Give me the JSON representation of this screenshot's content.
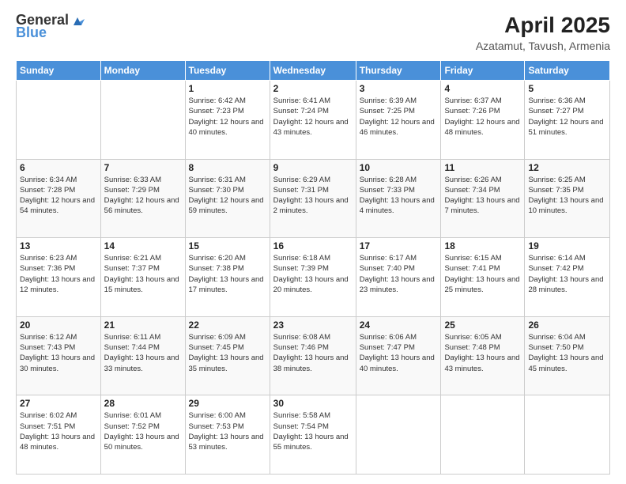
{
  "header": {
    "logo": {
      "text_general": "General",
      "text_blue": "Blue"
    },
    "title": "April 2025",
    "location": "Azatamut, Tavush, Armenia"
  },
  "calendar": {
    "days_of_week": [
      "Sunday",
      "Monday",
      "Tuesday",
      "Wednesday",
      "Thursday",
      "Friday",
      "Saturday"
    ],
    "weeks": [
      [
        {
          "day": "",
          "info": ""
        },
        {
          "day": "",
          "info": ""
        },
        {
          "day": "1",
          "info": "Sunrise: 6:42 AM\nSunset: 7:23 PM\nDaylight: 12 hours and 40 minutes."
        },
        {
          "day": "2",
          "info": "Sunrise: 6:41 AM\nSunset: 7:24 PM\nDaylight: 12 hours and 43 minutes."
        },
        {
          "day": "3",
          "info": "Sunrise: 6:39 AM\nSunset: 7:25 PM\nDaylight: 12 hours and 46 minutes."
        },
        {
          "day": "4",
          "info": "Sunrise: 6:37 AM\nSunset: 7:26 PM\nDaylight: 12 hours and 48 minutes."
        },
        {
          "day": "5",
          "info": "Sunrise: 6:36 AM\nSunset: 7:27 PM\nDaylight: 12 hours and 51 minutes."
        }
      ],
      [
        {
          "day": "6",
          "info": "Sunrise: 6:34 AM\nSunset: 7:28 PM\nDaylight: 12 hours and 54 minutes."
        },
        {
          "day": "7",
          "info": "Sunrise: 6:33 AM\nSunset: 7:29 PM\nDaylight: 12 hours and 56 minutes."
        },
        {
          "day": "8",
          "info": "Sunrise: 6:31 AM\nSunset: 7:30 PM\nDaylight: 12 hours and 59 minutes."
        },
        {
          "day": "9",
          "info": "Sunrise: 6:29 AM\nSunset: 7:31 PM\nDaylight: 13 hours and 2 minutes."
        },
        {
          "day": "10",
          "info": "Sunrise: 6:28 AM\nSunset: 7:33 PM\nDaylight: 13 hours and 4 minutes."
        },
        {
          "day": "11",
          "info": "Sunrise: 6:26 AM\nSunset: 7:34 PM\nDaylight: 13 hours and 7 minutes."
        },
        {
          "day": "12",
          "info": "Sunrise: 6:25 AM\nSunset: 7:35 PM\nDaylight: 13 hours and 10 minutes."
        }
      ],
      [
        {
          "day": "13",
          "info": "Sunrise: 6:23 AM\nSunset: 7:36 PM\nDaylight: 13 hours and 12 minutes."
        },
        {
          "day": "14",
          "info": "Sunrise: 6:21 AM\nSunset: 7:37 PM\nDaylight: 13 hours and 15 minutes."
        },
        {
          "day": "15",
          "info": "Sunrise: 6:20 AM\nSunset: 7:38 PM\nDaylight: 13 hours and 17 minutes."
        },
        {
          "day": "16",
          "info": "Sunrise: 6:18 AM\nSunset: 7:39 PM\nDaylight: 13 hours and 20 minutes."
        },
        {
          "day": "17",
          "info": "Sunrise: 6:17 AM\nSunset: 7:40 PM\nDaylight: 13 hours and 23 minutes."
        },
        {
          "day": "18",
          "info": "Sunrise: 6:15 AM\nSunset: 7:41 PM\nDaylight: 13 hours and 25 minutes."
        },
        {
          "day": "19",
          "info": "Sunrise: 6:14 AM\nSunset: 7:42 PM\nDaylight: 13 hours and 28 minutes."
        }
      ],
      [
        {
          "day": "20",
          "info": "Sunrise: 6:12 AM\nSunset: 7:43 PM\nDaylight: 13 hours and 30 minutes."
        },
        {
          "day": "21",
          "info": "Sunrise: 6:11 AM\nSunset: 7:44 PM\nDaylight: 13 hours and 33 minutes."
        },
        {
          "day": "22",
          "info": "Sunrise: 6:09 AM\nSunset: 7:45 PM\nDaylight: 13 hours and 35 minutes."
        },
        {
          "day": "23",
          "info": "Sunrise: 6:08 AM\nSunset: 7:46 PM\nDaylight: 13 hours and 38 minutes."
        },
        {
          "day": "24",
          "info": "Sunrise: 6:06 AM\nSunset: 7:47 PM\nDaylight: 13 hours and 40 minutes."
        },
        {
          "day": "25",
          "info": "Sunrise: 6:05 AM\nSunset: 7:48 PM\nDaylight: 13 hours and 43 minutes."
        },
        {
          "day": "26",
          "info": "Sunrise: 6:04 AM\nSunset: 7:50 PM\nDaylight: 13 hours and 45 minutes."
        }
      ],
      [
        {
          "day": "27",
          "info": "Sunrise: 6:02 AM\nSunset: 7:51 PM\nDaylight: 13 hours and 48 minutes."
        },
        {
          "day": "28",
          "info": "Sunrise: 6:01 AM\nSunset: 7:52 PM\nDaylight: 13 hours and 50 minutes."
        },
        {
          "day": "29",
          "info": "Sunrise: 6:00 AM\nSunset: 7:53 PM\nDaylight: 13 hours and 53 minutes."
        },
        {
          "day": "30",
          "info": "Sunrise: 5:58 AM\nSunset: 7:54 PM\nDaylight: 13 hours and 55 minutes."
        },
        {
          "day": "",
          "info": ""
        },
        {
          "day": "",
          "info": ""
        },
        {
          "day": "",
          "info": ""
        }
      ]
    ]
  }
}
